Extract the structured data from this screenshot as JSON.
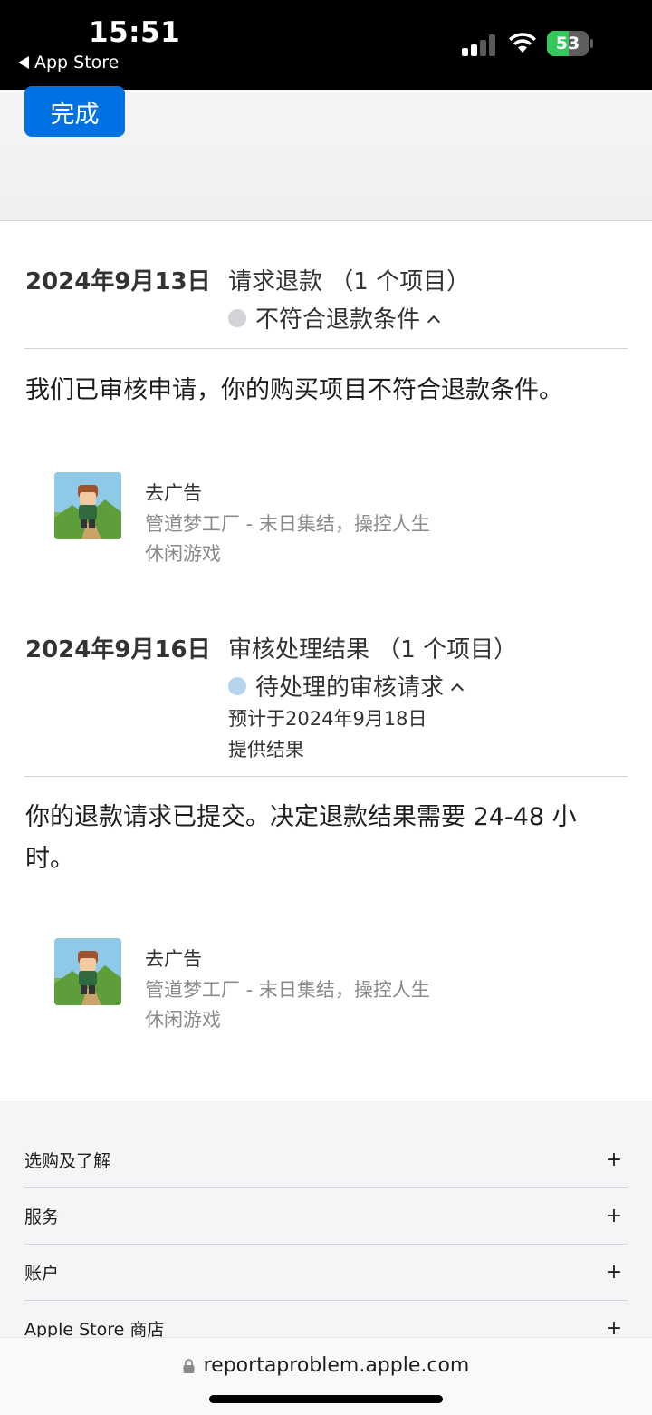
{
  "status_bar": {
    "time": "15:51",
    "back_label": "App Store",
    "battery_percent": 53,
    "battery_text": "53",
    "signal_bars_active": 2,
    "signal_bars_total": 4
  },
  "header": {
    "done_label": "完成"
  },
  "requests": [
    {
      "date": "2024年9月13日",
      "title": "请求退款 （1 个项目）",
      "status": "不符合退款条件",
      "status_color": "#d2d2d7",
      "message": "我们已审核申请，你的购买项目不符合退款条件。",
      "item": {
        "name": "去广告",
        "developer": "管道梦工厂 - 末日集结，操控人生",
        "category": "休闲游戏"
      }
    },
    {
      "date": "2024年9月16日",
      "title": "审核处理结果 （1 个项目）",
      "status": "待处理的审核请求",
      "status_color": "#b7d4ee",
      "estimate_line1": "预计于2024年9月18日",
      "estimate_line2": "提供结果",
      "message": "你的退款请求已提交。决定退款结果需要 24-48 小时。",
      "item": {
        "name": "去广告",
        "developer": "管道梦工厂 - 末日集结，操控人生",
        "category": "休闲游戏"
      }
    }
  ],
  "footer": {
    "sections": [
      {
        "label": "选购及了解",
        "icon": "+"
      },
      {
        "label": "服务",
        "icon": "+"
      },
      {
        "label": "账户",
        "icon": "+"
      },
      {
        "label": "Apple Store 商店",
        "icon": "+"
      }
    ]
  },
  "address_bar": {
    "url": "reportaproblem.apple.com"
  },
  "colors": {
    "accent": "#0071e3",
    "battery_green": "#34c759"
  }
}
